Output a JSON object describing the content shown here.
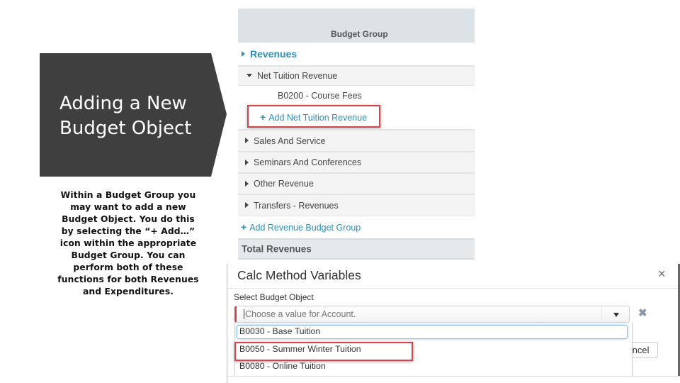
{
  "slide": {
    "title": "Adding a New\nBudget Object",
    "description": "Within a Budget Group you may want to add a new Budget Object. You do this by selecting the “+ Add…” icon within the appropriate Budget Group.  You can perform both of these functions for both Revenues and Expenditures."
  },
  "tree": {
    "header": "Budget Group",
    "section": "Revenues",
    "expanded_group": "Net Tuition Revenue",
    "objects": [
      "B0200 - Course Fees"
    ],
    "add_object_label": "Add Net Tuition Revenue",
    "groups": [
      "Sales And Service",
      "Seminars And Conferences",
      "Other Revenue",
      "Transfers - Revenues"
    ],
    "add_group_label": "Add Revenue Budget Group",
    "total_label": "Total Revenues"
  },
  "modal": {
    "title": "Calc Method Variables",
    "close_icon": "×",
    "field_label": "Select Budget Object",
    "placeholder": "Choose a value for Account.",
    "clear_icon": "✖",
    "options": [
      "B0030 - Base Tuition",
      "B0050 - Summer Winter Tuition",
      "B0080 - Online Tuition"
    ],
    "highlighted_option": "B0050 - Summer Winter Tuition",
    "cancel_label": "Cancel"
  },
  "colors": {
    "accent": "#2f8fb5",
    "highlight": "#d9434a",
    "banner": "#3f3f3f"
  }
}
